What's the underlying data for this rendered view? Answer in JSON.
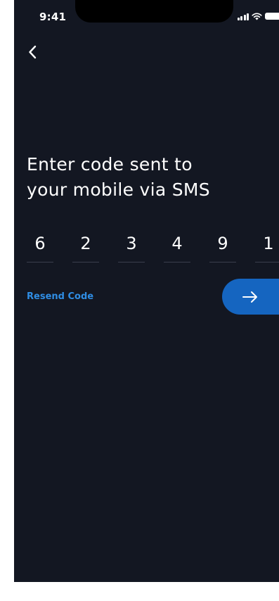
{
  "status_bar": {
    "time": "9:41",
    "icons": [
      "signal-icon",
      "wifi-icon",
      "battery-icon"
    ]
  },
  "nav": {
    "back_icon": "chevron-left-icon"
  },
  "title": {
    "line1": "Enter code sent to",
    "line2": "your mobile via SMS"
  },
  "code": {
    "digits": [
      "6",
      "2",
      "3",
      "4",
      "9",
      "1"
    ]
  },
  "actions": {
    "resend_label": "Resend Code",
    "next_icon": "arrow-right-icon"
  },
  "colors": {
    "background": "#131722",
    "accent": "#1565c0",
    "link": "#2f8de4",
    "text": "#ffffff"
  }
}
